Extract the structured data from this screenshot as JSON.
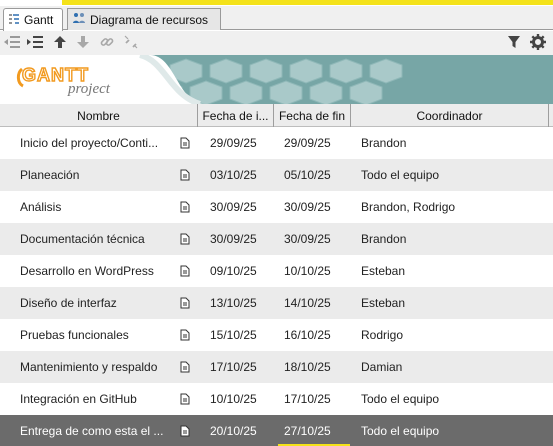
{
  "tabs": [
    {
      "label": "Gantt",
      "icon": "gantt-tasks-icon",
      "active": true
    },
    {
      "label": "Diagrama de recursos",
      "icon": "resources-icon",
      "active": false
    }
  ],
  "toolbar": {
    "left": [
      "outdent-icon",
      "indent-icon",
      "move-up-icon",
      "move-down-icon",
      "link-icon",
      "unlink-icon"
    ],
    "right": [
      "filter-icon",
      "settings-icon"
    ]
  },
  "banner": {
    "logo_main": "GANTT",
    "logo_sub": "project"
  },
  "table": {
    "headers": {
      "name": "Nombre",
      "start": "Fecha de i...",
      "end": "Fecha de fin",
      "coordinator": "Coordinador"
    },
    "rows": [
      {
        "name": "Inicio del proyecto/Conti...",
        "start": "29/09/25",
        "end": "29/09/25",
        "coordinator": "Brandon"
      },
      {
        "name": "Planeación",
        "start": "03/10/25",
        "end": "05/10/25",
        "coordinator": "Todo el equipo"
      },
      {
        "name": "Análisis",
        "start": "30/09/25",
        "end": "30/09/25",
        "coordinator": "Brandon, Rodrigo"
      },
      {
        "name": "Documentación técnica",
        "start": "30/09/25",
        "end": "30/09/25",
        "coordinator": "Brandon"
      },
      {
        "name": "Desarrollo en WordPress",
        "start": "09/10/25",
        "end": "10/10/25",
        "coordinator": "Esteban"
      },
      {
        "name": "Diseño de interfaz",
        "start": "13/10/25",
        "end": "14/10/25",
        "coordinator": "Esteban"
      },
      {
        "name": "Pruebas funcionales",
        "start": "15/10/25",
        "end": "16/10/25",
        "coordinator": "Rodrigo"
      },
      {
        "name": "Mantenimiento y respaldo",
        "start": "17/10/25",
        "end": "18/10/25",
        "coordinator": "Damian"
      },
      {
        "name": "Integración en GitHub",
        "start": "10/10/25",
        "end": "17/10/25",
        "coordinator": "Todo el equipo"
      },
      {
        "name": "Entrega de como esta el ...",
        "start": "20/10/25",
        "end": "27/10/25",
        "coordinator": "Todo el equipo"
      }
    ],
    "selected_row": 9
  },
  "colors": {
    "accent": "#f4e21a",
    "banner": "#77a6a6",
    "selected": "#6b6b6b",
    "logo": "#f29a1f"
  }
}
